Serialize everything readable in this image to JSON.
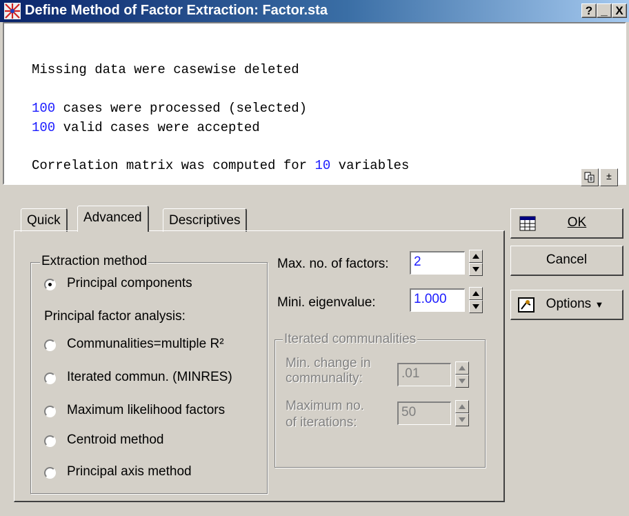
{
  "window": {
    "title": "Define Method of Factor Extraction: Factor.sta",
    "help_glyph": "?",
    "minimize_glyph": "_",
    "close_glyph": "X"
  },
  "log": {
    "line1": "Missing data were casewise deleted",
    "line2_num": "100",
    "line2_text": " cases were processed (selected)",
    "line3_num": "100",
    "line3_text": " valid cases were accepted",
    "line4_text_a": "Correlation matrix was computed for ",
    "line4_num": "10",
    "line4_text_b": " variables",
    "expand_glyph": "±"
  },
  "tabs": [
    {
      "label": "Quick"
    },
    {
      "label": "Advanced"
    },
    {
      "label": "Descriptives"
    }
  ],
  "extraction": {
    "group_label": "Extraction method",
    "principal_components": "Principal components",
    "pfa_heading": "Principal factor analysis:",
    "options": [
      {
        "label": "Communalities=multiple R²"
      },
      {
        "label": "Iterated commun. (MINRES)"
      },
      {
        "label": "Maximum likelihood factors"
      },
      {
        "label": "Centroid method"
      },
      {
        "label": "Principal axis method"
      }
    ],
    "selected": "Principal components"
  },
  "factors": {
    "max_label": "Max. no. of factors:",
    "max_value": "2",
    "eigen_label": "Mini. eigenvalue:",
    "eigen_value": "1.000"
  },
  "iterated": {
    "group_label": "Iterated communalities",
    "min_change_label_1": "Min. change in",
    "min_change_label_2": "communality:",
    "min_change_value": ".01",
    "max_iter_label_1": "Maximum no.",
    "max_iter_label_2": "of iterations:",
    "max_iter_value": "50"
  },
  "buttons": {
    "ok": "OK",
    "cancel": "Cancel",
    "options": "Options"
  }
}
